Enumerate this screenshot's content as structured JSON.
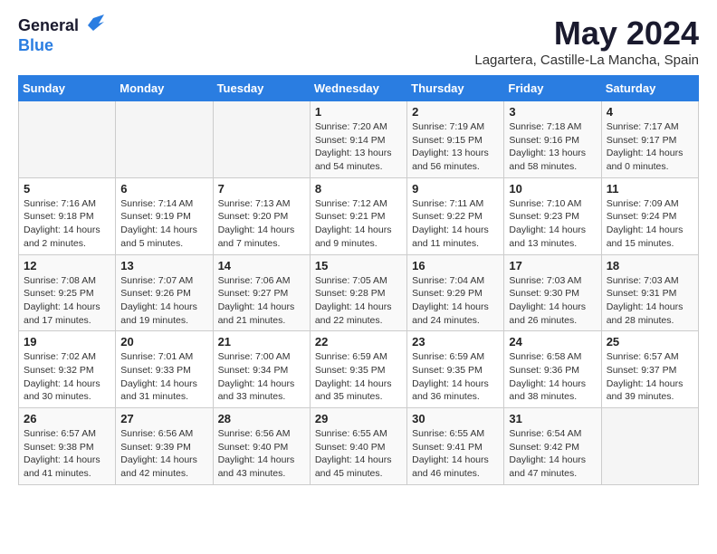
{
  "header": {
    "logo_general": "General",
    "logo_blue": "Blue",
    "title": "May 2024",
    "location": "Lagartera, Castille-La Mancha, Spain"
  },
  "weekdays": [
    "Sunday",
    "Monday",
    "Tuesday",
    "Wednesday",
    "Thursday",
    "Friday",
    "Saturday"
  ],
  "weeks": [
    [
      {
        "day": null,
        "info": null
      },
      {
        "day": null,
        "info": null
      },
      {
        "day": null,
        "info": null
      },
      {
        "day": "1",
        "info": "Sunrise: 7:20 AM\nSunset: 9:14 PM\nDaylight: 13 hours\nand 54 minutes."
      },
      {
        "day": "2",
        "info": "Sunrise: 7:19 AM\nSunset: 9:15 PM\nDaylight: 13 hours\nand 56 minutes."
      },
      {
        "day": "3",
        "info": "Sunrise: 7:18 AM\nSunset: 9:16 PM\nDaylight: 13 hours\nand 58 minutes."
      },
      {
        "day": "4",
        "info": "Sunrise: 7:17 AM\nSunset: 9:17 PM\nDaylight: 14 hours\nand 0 minutes."
      }
    ],
    [
      {
        "day": "5",
        "info": "Sunrise: 7:16 AM\nSunset: 9:18 PM\nDaylight: 14 hours\nand 2 minutes."
      },
      {
        "day": "6",
        "info": "Sunrise: 7:14 AM\nSunset: 9:19 PM\nDaylight: 14 hours\nand 5 minutes."
      },
      {
        "day": "7",
        "info": "Sunrise: 7:13 AM\nSunset: 9:20 PM\nDaylight: 14 hours\nand 7 minutes."
      },
      {
        "day": "8",
        "info": "Sunrise: 7:12 AM\nSunset: 9:21 PM\nDaylight: 14 hours\nand 9 minutes."
      },
      {
        "day": "9",
        "info": "Sunrise: 7:11 AM\nSunset: 9:22 PM\nDaylight: 14 hours\nand 11 minutes."
      },
      {
        "day": "10",
        "info": "Sunrise: 7:10 AM\nSunset: 9:23 PM\nDaylight: 14 hours\nand 13 minutes."
      },
      {
        "day": "11",
        "info": "Sunrise: 7:09 AM\nSunset: 9:24 PM\nDaylight: 14 hours\nand 15 minutes."
      }
    ],
    [
      {
        "day": "12",
        "info": "Sunrise: 7:08 AM\nSunset: 9:25 PM\nDaylight: 14 hours\nand 17 minutes."
      },
      {
        "day": "13",
        "info": "Sunrise: 7:07 AM\nSunset: 9:26 PM\nDaylight: 14 hours\nand 19 minutes."
      },
      {
        "day": "14",
        "info": "Sunrise: 7:06 AM\nSunset: 9:27 PM\nDaylight: 14 hours\nand 21 minutes."
      },
      {
        "day": "15",
        "info": "Sunrise: 7:05 AM\nSunset: 9:28 PM\nDaylight: 14 hours\nand 22 minutes."
      },
      {
        "day": "16",
        "info": "Sunrise: 7:04 AM\nSunset: 9:29 PM\nDaylight: 14 hours\nand 24 minutes."
      },
      {
        "day": "17",
        "info": "Sunrise: 7:03 AM\nSunset: 9:30 PM\nDaylight: 14 hours\nand 26 minutes."
      },
      {
        "day": "18",
        "info": "Sunrise: 7:03 AM\nSunset: 9:31 PM\nDaylight: 14 hours\nand 28 minutes."
      }
    ],
    [
      {
        "day": "19",
        "info": "Sunrise: 7:02 AM\nSunset: 9:32 PM\nDaylight: 14 hours\nand 30 minutes."
      },
      {
        "day": "20",
        "info": "Sunrise: 7:01 AM\nSunset: 9:33 PM\nDaylight: 14 hours\nand 31 minutes."
      },
      {
        "day": "21",
        "info": "Sunrise: 7:00 AM\nSunset: 9:34 PM\nDaylight: 14 hours\nand 33 minutes."
      },
      {
        "day": "22",
        "info": "Sunrise: 6:59 AM\nSunset: 9:35 PM\nDaylight: 14 hours\nand 35 minutes."
      },
      {
        "day": "23",
        "info": "Sunrise: 6:59 AM\nSunset: 9:35 PM\nDaylight: 14 hours\nand 36 minutes."
      },
      {
        "day": "24",
        "info": "Sunrise: 6:58 AM\nSunset: 9:36 PM\nDaylight: 14 hours\nand 38 minutes."
      },
      {
        "day": "25",
        "info": "Sunrise: 6:57 AM\nSunset: 9:37 PM\nDaylight: 14 hours\nand 39 minutes."
      }
    ],
    [
      {
        "day": "26",
        "info": "Sunrise: 6:57 AM\nSunset: 9:38 PM\nDaylight: 14 hours\nand 41 minutes."
      },
      {
        "day": "27",
        "info": "Sunrise: 6:56 AM\nSunset: 9:39 PM\nDaylight: 14 hours\nand 42 minutes."
      },
      {
        "day": "28",
        "info": "Sunrise: 6:56 AM\nSunset: 9:40 PM\nDaylight: 14 hours\nand 43 minutes."
      },
      {
        "day": "29",
        "info": "Sunrise: 6:55 AM\nSunset: 9:40 PM\nDaylight: 14 hours\nand 45 minutes."
      },
      {
        "day": "30",
        "info": "Sunrise: 6:55 AM\nSunset: 9:41 PM\nDaylight: 14 hours\nand 46 minutes."
      },
      {
        "day": "31",
        "info": "Sunrise: 6:54 AM\nSunset: 9:42 PM\nDaylight: 14 hours\nand 47 minutes."
      },
      {
        "day": null,
        "info": null
      }
    ]
  ]
}
